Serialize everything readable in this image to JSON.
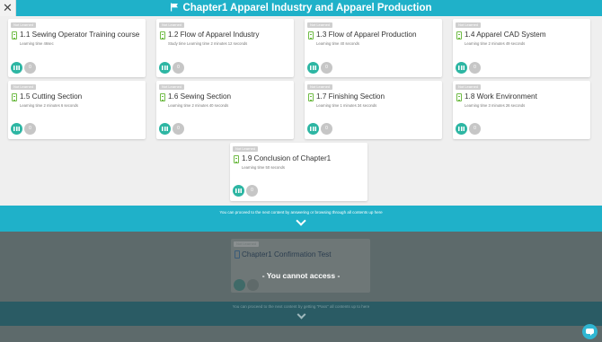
{
  "header": {
    "close_glyph": "✕",
    "title": "Chapter1 Apparel Industry and Apparel Production",
    "flag_icon": "flag-icon",
    "color": "#1fb1c9"
  },
  "cards": [
    {
      "badge": "Not Learned",
      "title": "1.1 Sewing Operator Training course",
      "time": "Learning time 46sec",
      "likes": "0"
    },
    {
      "badge": "Not Learned",
      "title": "1.2 Flow of Apparel Industry",
      "time": "Study time Learning time 2 minutes 12 seconds",
      "likes": "0"
    },
    {
      "badge": "Not Learned",
      "title": "1.3 Flow of Apparel Production",
      "time": "Learning time 40 seconds",
      "likes": "0"
    },
    {
      "badge": "Not Learned",
      "title": "1.4 Apparel CAD System",
      "time": "Learning time 2 minutes 49 seconds",
      "likes": "0"
    },
    {
      "badge": "Not Learned",
      "title": "1.5 Cutting Section",
      "time": "Learning time 2 minutes 6 seconds",
      "likes": "0"
    },
    {
      "badge": "Not Learned",
      "title": "1.6 Sewing Section",
      "time": "Learning time 2 minutes 40 seconds",
      "likes": "0"
    },
    {
      "badge": "Not Learned",
      "title": "1.7 Finishing Section",
      "time": "Learning time 1 minutes 34 seconds",
      "likes": "0"
    },
    {
      "badge": "Not Learned",
      "title": "1.8 Work Environment",
      "time": "Learning time 3 minutes 26 seconds",
      "likes": "0"
    },
    {
      "badge": "Not Learned",
      "title": "1.9 Conclusion of Chapter1",
      "time": "Learning time 50 seconds",
      "likes": "0"
    }
  ],
  "proceed_band": {
    "text": "You can proceed to the next content by answering or browsing through all contents up here"
  },
  "locked_section": {
    "badge": "Not Learned",
    "title": "Chapter1 Confirmation Test",
    "message": "- You cannot access -",
    "band_text": "You can proceed to the next content by getting \"Pass\" all contents up to here"
  },
  "chat": {
    "icon": "chat-icon",
    "color": "#2fb6d2"
  }
}
